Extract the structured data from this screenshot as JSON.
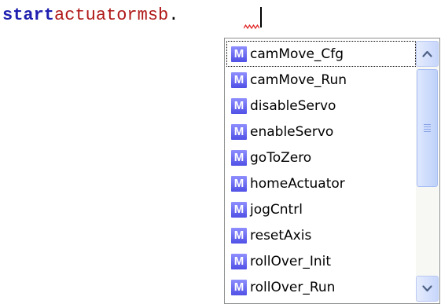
{
  "editor": {
    "keyword": "start",
    "tokens": [
      "actuator",
      "msb"
    ],
    "separator": "."
  },
  "autocomplete": {
    "badge_letter": "M",
    "selected_index": 0,
    "items": [
      "camMove_Cfg",
      "camMove_Run",
      "disableServo",
      "enableServo",
      "goToZero",
      "homeActuator",
      "jogCntrl",
      "resetAxis",
      "rollOver_Init",
      "rollOver_Run"
    ]
  },
  "colors": {
    "keyword": "#1f1fb0",
    "identifier": "#b01818",
    "method_badge": "#5050e6",
    "error_squiggle": "#e02020",
    "scrollbar_accent": "#b9c8f3"
  },
  "icons": {
    "method": "method-icon",
    "scroll_up": "chevron-up-icon",
    "scroll_down": "chevron-down-icon",
    "thumb_grip": "grip-icon"
  }
}
